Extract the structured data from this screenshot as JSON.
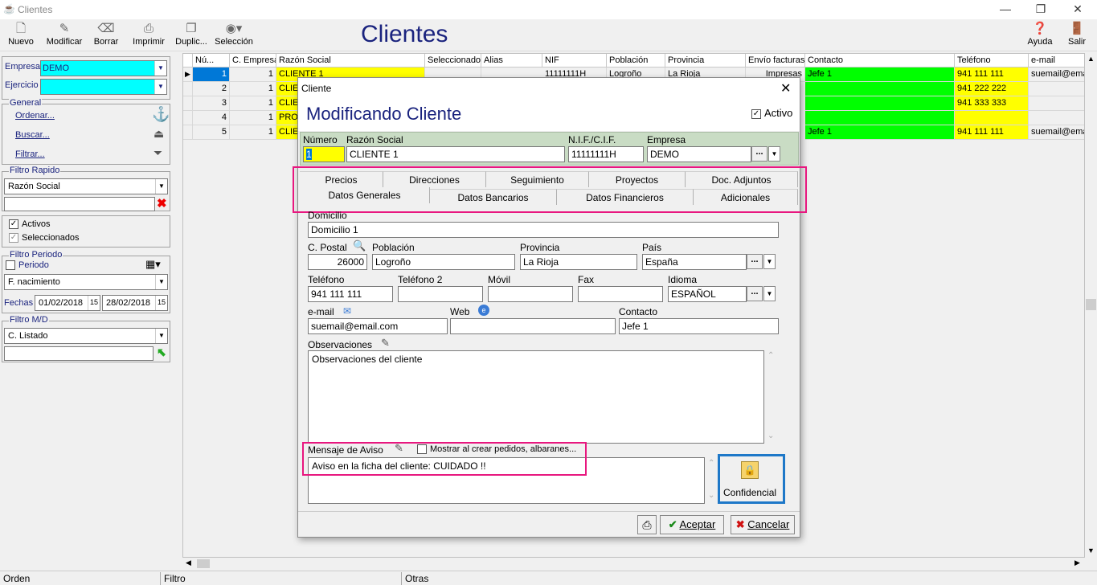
{
  "window": {
    "title": "Clientes",
    "minimize": "—",
    "restore": "❐",
    "close": "✕"
  },
  "toolbar": {
    "nuevo": "Nuevo",
    "modificar": "Modificar",
    "borrar": "Borrar",
    "imprimir": "Imprimir",
    "duplicar": "Duplic...",
    "seleccion": "Selección",
    "ayuda": "Ayuda",
    "salir": "Salir"
  },
  "app_title": "Clientes",
  "left": {
    "empresa_label": "Empresa",
    "empresa_value": "DEMO",
    "ejercicio_label": "Ejercicio",
    "ejercicio_value": "",
    "general_legend": "General",
    "ordenar": "Ordenar...",
    "buscar": "Buscar...",
    "filtrar": "Filtrar...",
    "filtro_rapido_legend": "Filtro Rapido",
    "filtro_rapido_value": "Razón Social",
    "filtro_rapido_text": "",
    "activos": "Activos",
    "seleccionados": "Seleccionados",
    "filtro_periodo_legend": "Filtro Periodo",
    "periodo": "Periodo",
    "periodo_field": "F. nacimiento",
    "fechas_label": "Fechas",
    "fecha_desde": "01/02/2018",
    "fecha_hasta": "28/02/2018",
    "filtro_md_legend": "Filtro M/D",
    "filtro_md_value": "C. Listado",
    "filtro_md_text": ""
  },
  "grid": {
    "headers": [
      "Nú...",
      "C. Empresa",
      "Razón Social",
      "Seleccionado",
      "Alias",
      "NIF",
      "Población",
      "Provincia",
      "Envío facturas",
      "Contacto",
      "Teléfono",
      "e-mail"
    ],
    "rows": [
      {
        "num": "1",
        "emp": "1",
        "razon": "CLIENTE 1",
        "nif": "11111111H",
        "pob": "Logroño",
        "prov": "La Rioja",
        "envio": "Impresas",
        "contacto": "Jefe 1",
        "tel": "941 111 111",
        "email": "suemail@ema"
      },
      {
        "num": "2",
        "emp": "1",
        "razon": "CLIE",
        "nif": "",
        "pob": "",
        "prov": "",
        "envio": "",
        "contacto": "",
        "tel": "941 222 222",
        "email": ""
      },
      {
        "num": "3",
        "emp": "1",
        "razon": "CLIE",
        "nif": "",
        "pob": "",
        "prov": "",
        "envio": "",
        "contacto": "",
        "tel": "941 333 333",
        "email": ""
      },
      {
        "num": "4",
        "emp": "1",
        "razon": "PROV",
        "nif": "",
        "pob": "",
        "prov": "",
        "envio": "",
        "contacto": "",
        "tel": "",
        "email": ""
      },
      {
        "num": "5",
        "emp": "1",
        "razon": "CLIE",
        "nif": "",
        "pob": "",
        "prov": "",
        "envio": "",
        "contacto": "Jefe 1",
        "tel": "941 111 111",
        "email": "suemail@ema"
      }
    ]
  },
  "status": {
    "orden": "Orden",
    "filtro": "Filtro",
    "otras": "Otras"
  },
  "dialog": {
    "title": "Cliente",
    "heading": "Modificando Cliente",
    "activo_label": "Activo",
    "numero_label": "Número",
    "numero": "1",
    "razon_label": "Razón Social",
    "razon": "CLIENTE 1",
    "nif_label": "N.I.F./C.I.F.",
    "nif": "11111111H",
    "empresa_label": "Empresa",
    "empresa": "DEMO",
    "tabs_row1": [
      "Precios",
      "Direcciones",
      "Seguimiento",
      "Proyectos",
      "Doc. Adjuntos"
    ],
    "tabs_row2": [
      "Datos Generales",
      "Datos Bancarios",
      "Datos Financieros",
      "Adicionales"
    ],
    "domicilio_label": "Domicilio",
    "domicilio": "Domicilio 1",
    "cpostal_label": "C. Postal",
    "cpostal": "26000",
    "poblacion_label": "Población",
    "poblacion": "Logroño",
    "provincia_label": "Provincia",
    "provincia": "La Rioja",
    "pais_label": "País",
    "pais": "España",
    "telefono_label": "Teléfono",
    "telefono": "941 111 111",
    "telefono2_label": "Teléfono 2",
    "telefono2": "",
    "movil_label": "Móvil",
    "movil": "",
    "fax_label": "Fax",
    "fax": "",
    "idioma_label": "Idioma",
    "idioma": "ESPAÑOL",
    "email_label": "e-mail",
    "email": "suemail@email.com",
    "web_label": "Web",
    "web": "",
    "contacto_label": "Contacto",
    "contacto": "Jefe 1",
    "observaciones_label": "Observaciones",
    "observaciones": "Observaciones del cliente",
    "aviso_label": "Mensaje de Aviso",
    "mostrar_label": "Mostrar al crear pedidos, albaranes...",
    "aviso": "Aviso en la ficha del cliente: CUIDADO !!",
    "confidencial": "Confidencial",
    "aceptar": "Aceptar",
    "cancelar": "Cancelar"
  },
  "colors": {
    "accent": "#1a237e",
    "cyan": "#00ffff",
    "yellow": "#ffff00",
    "green": "#00ff00",
    "highlight": "#e8177f",
    "selected": "#0078d7"
  }
}
